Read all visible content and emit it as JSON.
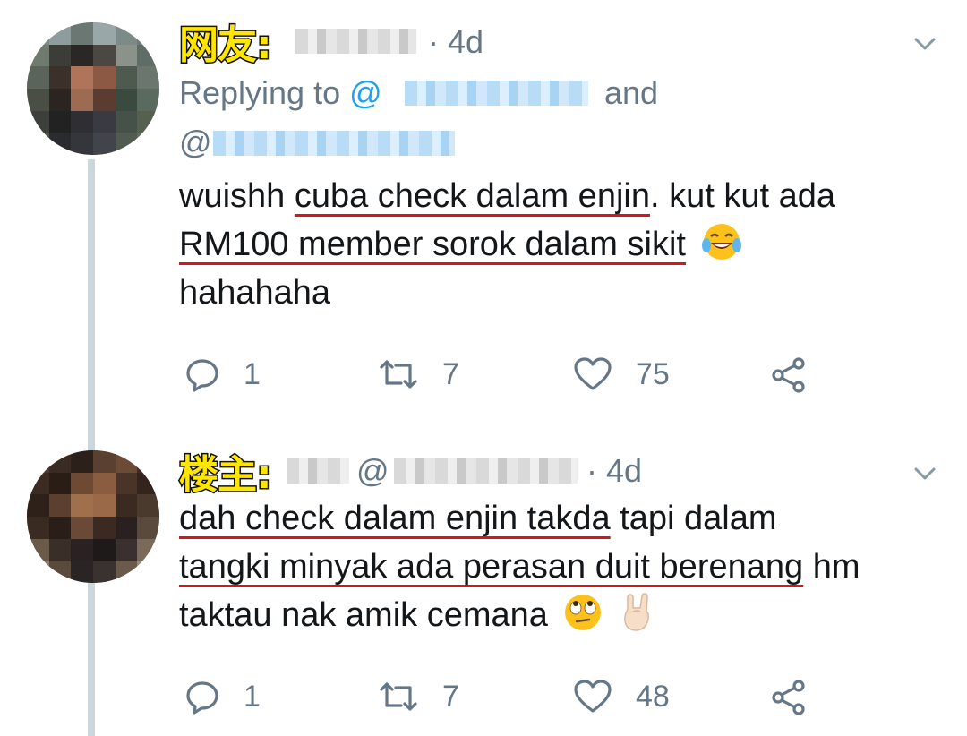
{
  "tweets": [
    {
      "tag": "网友:",
      "time": "· 4d",
      "replying_prefix": "Replying to",
      "at_symbol_1": "@",
      "and_word": "and",
      "at_symbol_2": "@",
      "body_underlined_1": "cuba check dalam enjin",
      "body_prefix": "wuishh ",
      "body_mid": ". kut kut ada",
      "body_underlined_2": "RM100 member sorok dalam sikit",
      "body_suffix": "hahahaha",
      "emoji_1": "face-with-tears-of-joy",
      "reply_count": "1",
      "retweet_count": "7",
      "like_count": "75"
    },
    {
      "tag": "楼主:",
      "at_symbol": "@",
      "time": "· 4d",
      "body_underlined_1": "dah check dalam enjin takda",
      "body_mid": " tapi dalam",
      "body_underlined_2": "tangki minyak ada perasan duit berenang",
      "body_mid_2": " hm",
      "body_suffix": "taktau nak amik cemana",
      "emoji_1": "face-with-rolling-eyes",
      "emoji_2": "sign-of-the-horns",
      "reply_count": "1",
      "retweet_count": "7",
      "like_count": "48"
    }
  ],
  "colors": {
    "accent": "#1da1f2",
    "muted": "#657786",
    "underline": "#d9141a",
    "tag": "#ffe600"
  },
  "icons": [
    "reply-icon",
    "retweet-icon",
    "like-icon",
    "share-icon",
    "chevron-down-icon"
  ]
}
